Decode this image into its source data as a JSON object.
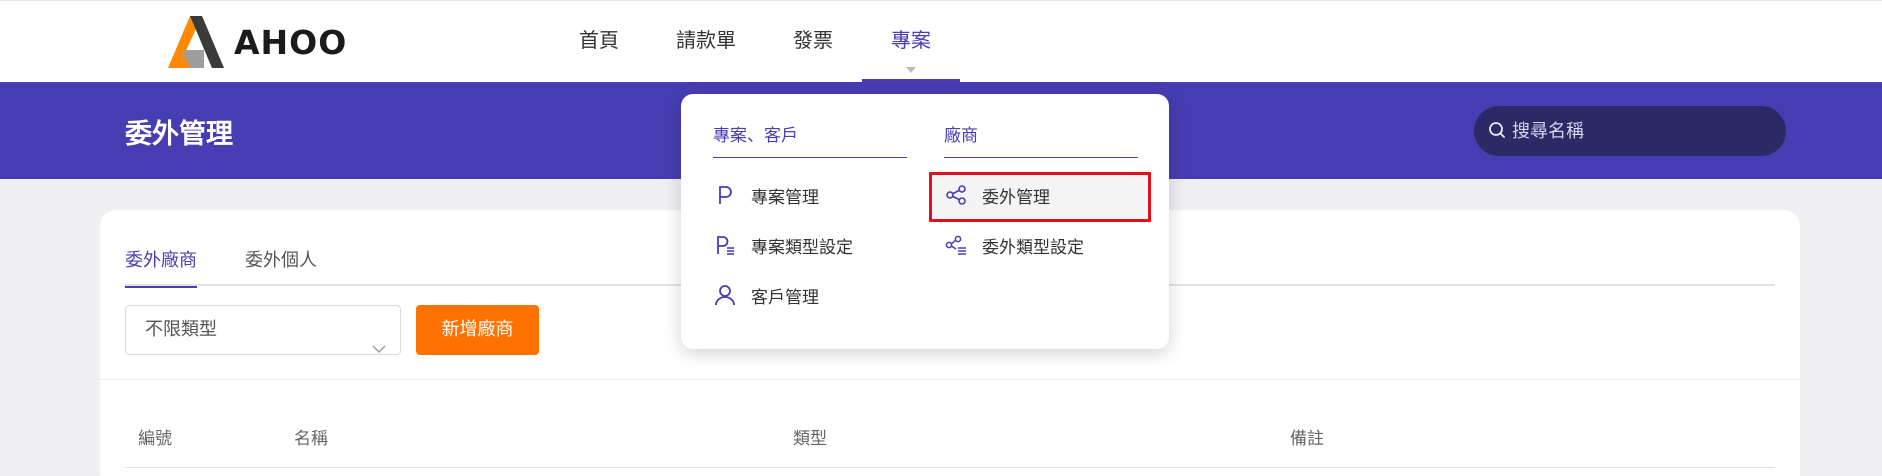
{
  "brand": {
    "name": "AHOO"
  },
  "topnav": {
    "items": [
      {
        "label": "首頁"
      },
      {
        "label": "請款單"
      },
      {
        "label": "發票"
      },
      {
        "label": "專案"
      }
    ],
    "active_index": 3
  },
  "header": {
    "title": "委外管理",
    "search": {
      "placeholder": "搜尋名稱",
      "value": ""
    }
  },
  "tabs": [
    {
      "label": "委外廠商"
    },
    {
      "label": "委外個人"
    }
  ],
  "filters": {
    "type_select": {
      "selected": "不限類型"
    },
    "add_button": "新增廠商"
  },
  "table": {
    "columns": [
      "編號",
      "名稱",
      "類型",
      "備註"
    ]
  },
  "dropdown": {
    "columns": [
      {
        "title": "專案、客戶",
        "items": [
          {
            "label": "專案管理",
            "icon": "p-letter-icon"
          },
          {
            "label": "專案類型設定",
            "icon": "p-list-icon"
          },
          {
            "label": "客戶管理",
            "icon": "user-icon"
          }
        ]
      },
      {
        "title": "廠商",
        "items": [
          {
            "label": "委外管理",
            "icon": "share-icon",
            "highlighted": true
          },
          {
            "label": "委外類型設定",
            "icon": "share-list-icon"
          }
        ]
      }
    ]
  },
  "colors": {
    "primary": "#473db3",
    "accent": "#ff7200",
    "highlight_border": "#e1121c",
    "search_bg": "#2c2a66"
  }
}
